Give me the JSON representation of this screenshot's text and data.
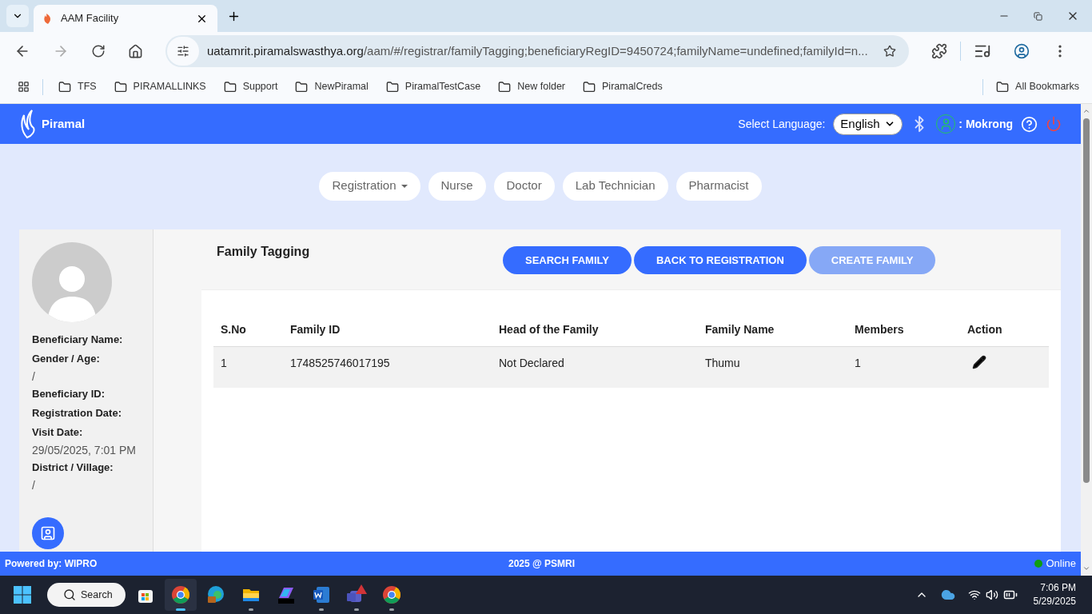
{
  "browser": {
    "tab": {
      "title": "AAM Facility"
    },
    "address": {
      "host": "uatamrit.piramalswasthya.org",
      "path": "/aam/#/registrar/familyTagging;beneficiaryRegID=9450724;familyName=undefined;familyId=n..."
    },
    "bookmarks": [
      {
        "label": "TFS"
      },
      {
        "label": "PIRAMALLINKS"
      },
      {
        "label": "Support"
      },
      {
        "label": "NewPiramal"
      },
      {
        "label": "PiramalTestCase"
      },
      {
        "label": "New folder"
      },
      {
        "label": "PiramalCreds"
      }
    ],
    "all_bookmarks": "All Bookmarks"
  },
  "header": {
    "logo": "Piramal",
    "language_label": "Select Language:",
    "language": "English",
    "user": ": Mokrong"
  },
  "nav": [
    {
      "label": "Registration",
      "has_menu": true
    },
    {
      "label": "Nurse",
      "has_menu": false
    },
    {
      "label": "Doctor",
      "has_menu": false
    },
    {
      "label": "Lab Technician",
      "has_menu": false
    },
    {
      "label": "Pharmacist",
      "has_menu": false
    }
  ],
  "beneficiary": [
    {
      "label": "Beneficiary Name:"
    },
    {
      "label": "Gender / Age:",
      "value": "/"
    },
    {
      "label": "Beneficiary ID:"
    },
    {
      "label": "Registration Date:"
    },
    {
      "label": "Visit Date:",
      "value": "29/05/2025, 7:01 PM"
    },
    {
      "label": "District / Village:",
      "value": "/"
    }
  ],
  "page_title": "Family Tagging",
  "actions": [
    {
      "label": "SEARCH FAMILY",
      "disabled": false
    },
    {
      "label": "BACK TO REGISTRATION",
      "disabled": false
    },
    {
      "label": "CREATE FAMILY",
      "disabled": true
    }
  ],
  "table": {
    "columns": [
      "S.No",
      "Family ID",
      "Head of the Family",
      "Family Name",
      "Members",
      "Action"
    ],
    "rows": [
      {
        "cells": [
          "1",
          "1748525746017195",
          "Not Declared",
          "Thumu",
          "1"
        ]
      }
    ]
  },
  "footer": {
    "left": "Powered by: WIPRO",
    "center": "2025 @ PSMRI",
    "status": {
      "label": "Online",
      "color": "#0f9d0f"
    }
  },
  "taskbar": {
    "search": "Search",
    "apps": [
      {
        "kind": "store",
        "selected": false,
        "running": false
      },
      {
        "kind": "chrome",
        "selected": true,
        "running": true
      },
      {
        "kind": "edge",
        "selected": false,
        "running": false
      },
      {
        "kind": "files",
        "selected": false,
        "running": true
      },
      {
        "kind": "m365",
        "selected": false,
        "running": false
      },
      {
        "kind": "word",
        "selected": false,
        "running": true
      },
      {
        "kind": "teams",
        "selected": false,
        "running": true
      },
      {
        "kind": "chrome",
        "selected": false,
        "running": true
      }
    ],
    "time": "7:06 PM",
    "date": "5/29/2025"
  }
}
